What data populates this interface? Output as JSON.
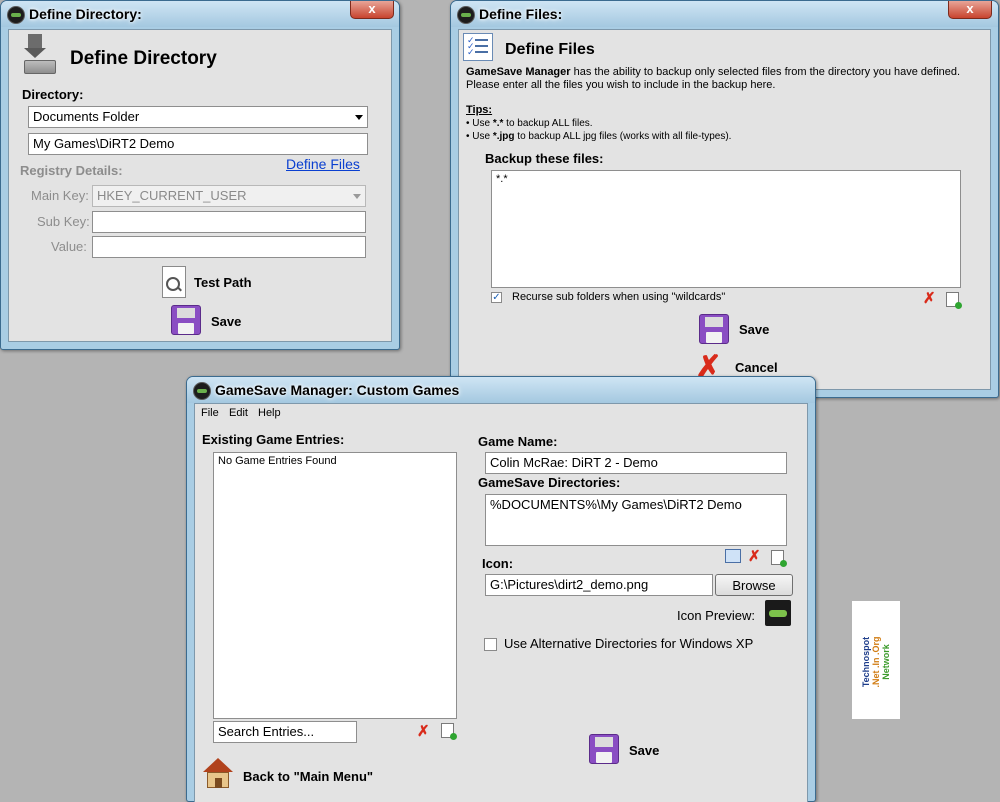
{
  "define_directory": {
    "title": "Define Directory:",
    "heading": "Define Directory",
    "directory_label": "Directory:",
    "directory_select": "Documents Folder",
    "directory_path": "My Games\\DiRT2 Demo",
    "registry_label": "Registry Details:",
    "define_files_link": "Define Files",
    "main_key_label": "Main Key:",
    "main_key_value": "HKEY_CURRENT_USER",
    "sub_key_label": "Sub Key:",
    "sub_key_value": "",
    "value_label": "Value:",
    "value_value": "",
    "test_path_label": "Test Path",
    "save_label": "Save",
    "close_glyph": "x"
  },
  "define_files": {
    "title": "Define Files:",
    "heading": "Define Files",
    "desc_brand": "GameSave Manager",
    "desc_line1": " has the ability to backup only selected files from the directory you have defined.",
    "desc_line2": "Please enter all the files you wish to include in the backup here.",
    "tips_label": "Tips:",
    "tip1_prefix": "Use ",
    "tip1_pattern": "*.*",
    "tip1_suffix": " to backup ALL files.",
    "tip2_prefix": "Use ",
    "tip2_pattern": "*.jpg",
    "tip2_suffix": " to backup ALL jpg files (works with all file-types).",
    "backup_label": "Backup these files:",
    "backup_content": "*.*",
    "recurse_label": "Recurse sub folders when using \"wildcards\"",
    "recurse_checked": true,
    "check_glyph": "✓",
    "save_label": "Save",
    "cancel_label": "Cancel",
    "close_glyph": "x"
  },
  "custom_games": {
    "title": "GameSave Manager: Custom Games",
    "menu": [
      "File",
      "Edit",
      "Help"
    ],
    "existing_label": "Existing Game Entries:",
    "no_entries": "No Game Entries Found",
    "search_placeholder": "Search Entries...",
    "game_name_label": "Game Name:",
    "game_name_value": "Colin McRae: DiRT 2 - Demo",
    "directories_label": "GameSave Directories:",
    "directories_value": "%DOCUMENTS%\\My Games\\DiRT2 Demo",
    "icon_label": "Icon:",
    "icon_path": "G:\\Pictures\\dirt2_demo.png",
    "browse_label": "Browse",
    "icon_preview_label": "Icon Preview:",
    "alt_dirs_label": "Use Alternative Directories for Windows XP",
    "save_label": "Save",
    "back_label": "Back to \"Main Menu\"",
    "x_glyph": "✗"
  },
  "watermark": {
    "line1": "Technospot",
    "line2": ".Net .In .Org",
    "line3": "Network"
  },
  "colors": {
    "accent_link": "#0a3fd0",
    "close_red": "#c8442e",
    "delete_red": "#d92b1b",
    "save_purple": "#8a4ec3"
  }
}
